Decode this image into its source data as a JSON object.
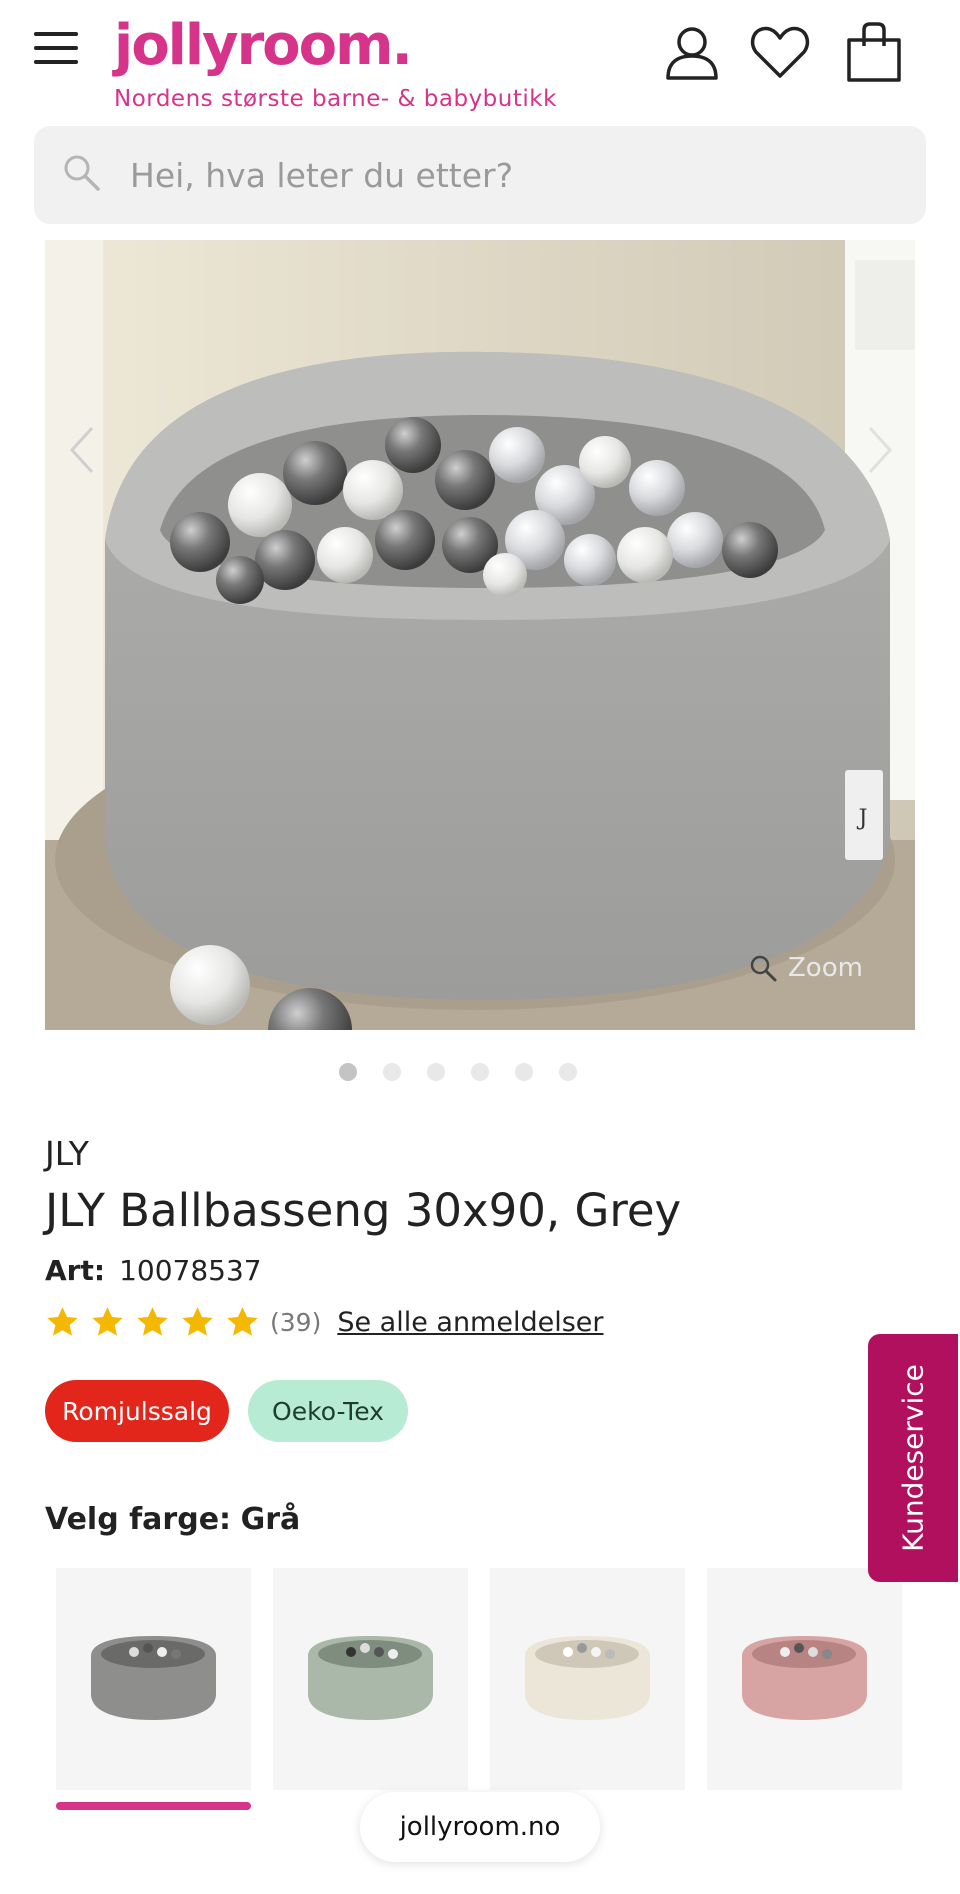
{
  "header": {
    "logo": "jollyroom.",
    "tagline": "Nordens største barne- & babybutikk",
    "icons": [
      "menu-icon",
      "account-icon",
      "heart-icon",
      "shopping-bag-icon"
    ]
  },
  "search": {
    "placeholder": "Hei, hva leter du etter?"
  },
  "gallery": {
    "zoom_label": "Zoom",
    "image_count": 6,
    "active_index": 0
  },
  "product": {
    "brand": "JLY",
    "title": "JLY Ballbasseng 30x90, Grey",
    "art_label": "Art:",
    "art_number": "10078537",
    "rating": 5,
    "review_count": "(39)",
    "all_reviews_link": "Se alle anmeldelser",
    "badges": {
      "sale": "Romjulssalg",
      "certification": "Oeko-Tex"
    }
  },
  "color_select": {
    "label": "Velg farge:",
    "selected": "Grå",
    "selected_index": 0,
    "swatch_colors": [
      "#8e8e8c",
      "#a9b8a8",
      "#ece6d9",
      "#d7a3a3"
    ]
  },
  "kundeservice": "Kundeservice",
  "browser": {
    "url": "jollyroom.no"
  },
  "colors": {
    "brand": "#d6338a",
    "sale": "#e3261b",
    "oeko": "#b8ebd3",
    "service": "#b1105f",
    "star": "#f5b800"
  }
}
